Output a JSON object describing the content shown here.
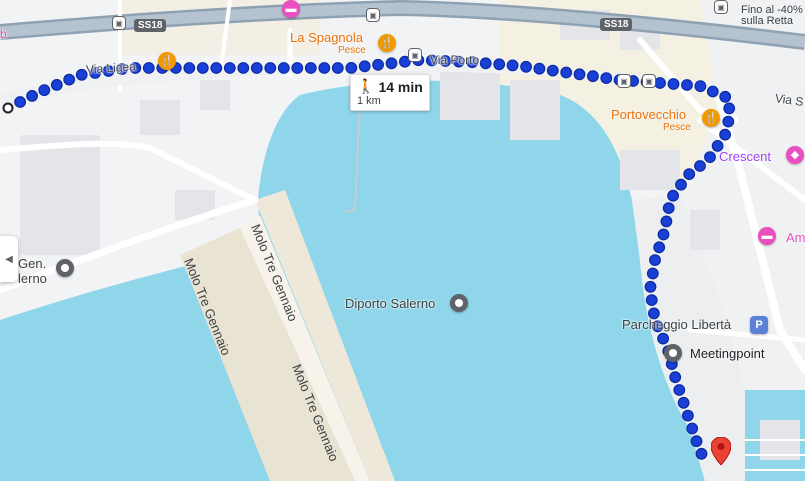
{
  "map": {
    "roads": {
      "via_liguria": "Via Ligea",
      "via_porto": "Via Porto",
      "ss18_left": "SS18",
      "ss18_right": "SS18",
      "via_s_right": "Via S",
      "gen_left": "Gen.",
      "lerno_left": "lerno"
    },
    "piers": {
      "molo1": "Molo Tre Gennaio",
      "molo2": "Molo Tre Gennaio",
      "molo3": "Molo Tre Gennaio"
    },
    "pois": {
      "la_spagnola": {
        "name": "La Spagnola",
        "sub": "Pesce"
      },
      "portovecchio": {
        "name": "Portovecchio",
        "sub": "Pesce"
      },
      "diporto": "Diporto Salerno",
      "crescent": "Crescent",
      "parcheggio": "Parcheggio Libertà",
      "meetingpoint": "Meetingpoint",
      "am": "Am",
      "parking_symbol": "P",
      "corner_note_1": "Fino al -40%",
      "corner_note_2": "sulla Retta",
      "left_fragment": "b"
    },
    "route": {
      "mode": "walking",
      "time": "14 min",
      "distance": "1 km",
      "color": "#1a3fd6"
    },
    "icons": {
      "walk": "walking-person-icon",
      "restaurant": "fork-knife-icon",
      "hotel": "bed-icon",
      "bus": "bus-icon",
      "destination": "red-pin-icon",
      "collapse": "chevron-left-icon"
    },
    "colors": {
      "water": "#8fd6ea",
      "land": "#f1f3f4",
      "road": "#ffffff",
      "highway": "#8ea2b4",
      "pier": "#e9e3d4",
      "building": "#e8e8ea",
      "route": "#1a3fd6",
      "poi_food": "#f29900",
      "poi_pink": "#e94fbf",
      "poi_gray": "#5f6368"
    }
  }
}
